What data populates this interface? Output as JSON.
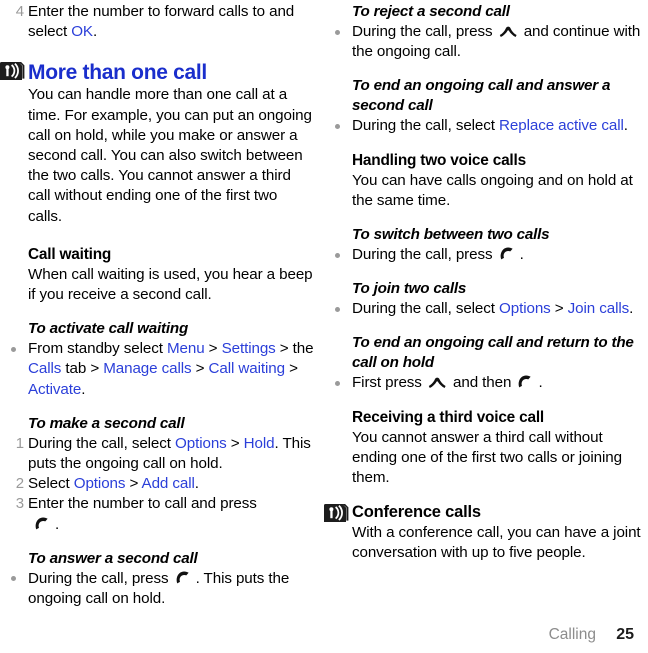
{
  "document": {
    "type": "mobile-phone-user-guide-page",
    "footer": {
      "section": "Calling",
      "page_number": "25"
    },
    "link_color": "#2b3fd9",
    "heading_color": "#1a2ecc",
    "marker_color": "#9a9a9a"
  },
  "left_column": {
    "step4": {
      "number": "4",
      "text_before": "Enter the number to forward calls to and select ",
      "link": "OK",
      "text_after": "."
    },
    "section": {
      "icon": "broadcast-tower-icon",
      "title": "More than one call",
      "body": "You can handle more than one call at a time. For example, you can put an ongoing call on hold, while you make or answer a second call. You can also switch between the two calls. You cannot answer a third call without ending one of the first two calls."
    },
    "call_waiting": {
      "heading": "Call waiting",
      "body": "When call waiting is used, you hear a beep if you receive a second call."
    },
    "activate_call_waiting": {
      "heading": "To activate call waiting",
      "bullet": {
        "t1": "From standby select ",
        "l1": "Menu",
        "t2": " > ",
        "l2": "Settings",
        "t3": " > the ",
        "l3": "Calls",
        "t4": " tab > ",
        "l4": "Manage calls",
        "t5": " > ",
        "l5": "Call waiting",
        "t6": " > ",
        "l6": "Activate",
        "t7": "."
      }
    },
    "make_second_call": {
      "heading": "To make a second call",
      "steps": [
        {
          "number": "1",
          "t1": "During the call, select ",
          "l1": "Options",
          "t2": " > ",
          "l2": "Hold",
          "t3": ". This puts the ongoing call on hold."
        },
        {
          "number": "2",
          "t1": "Select ",
          "l1": "Options",
          "t2": " > ",
          "l2": "Add call",
          "t3": "."
        },
        {
          "number": "3",
          "t1": "Enter the number to call and press ",
          "icon": "answer-call-key-icon",
          "t3": "."
        }
      ]
    },
    "answer_second_call": {
      "heading": "To answer a second call",
      "bullet": {
        "t1": "During the call, press ",
        "icon": "answer-call-key-icon",
        "t2": ". This puts the ongoing call on hold."
      }
    }
  },
  "right_column": {
    "reject_second_call": {
      "heading": "To reject a second call",
      "bullet": {
        "t1": "During the call, press ",
        "icon": "end-call-key-icon",
        "t2": " and continue with the ongoing call."
      }
    },
    "end_and_answer": {
      "heading": "To end an ongoing call and answer a second call",
      "bullet": {
        "t1": "During the call, select ",
        "l1": "Replace active call",
        "t2": "."
      }
    },
    "handling_two_calls": {
      "heading": "Handling two voice calls",
      "body": "You can have calls ongoing and on hold at the same time."
    },
    "switch_two_calls": {
      "heading": "To switch between two calls",
      "bullet": {
        "t1": "During the call, press ",
        "icon": "answer-call-key-icon",
        "t2": "."
      }
    },
    "join_two_calls": {
      "heading": "To join two calls",
      "bullet": {
        "t1": "During the call, select ",
        "l1": "Options",
        "t2": " > ",
        "l2": "Join calls",
        "t3": "."
      }
    },
    "end_return_hold": {
      "heading": "To end an ongoing call and return to the call on hold",
      "bullet": {
        "t1": "First press ",
        "icon1": "end-call-key-icon",
        "t2": " and then ",
        "icon2": "answer-call-key-icon",
        "t3": "."
      }
    },
    "third_voice_call": {
      "heading": "Receiving a third voice call",
      "body": "You cannot answer a third call without ending one of the first two calls or joining them."
    },
    "conference_calls": {
      "icon": "broadcast-tower-icon",
      "heading": "Conference calls",
      "body": "With a conference call, you can have a joint conversation with up to five people."
    }
  }
}
